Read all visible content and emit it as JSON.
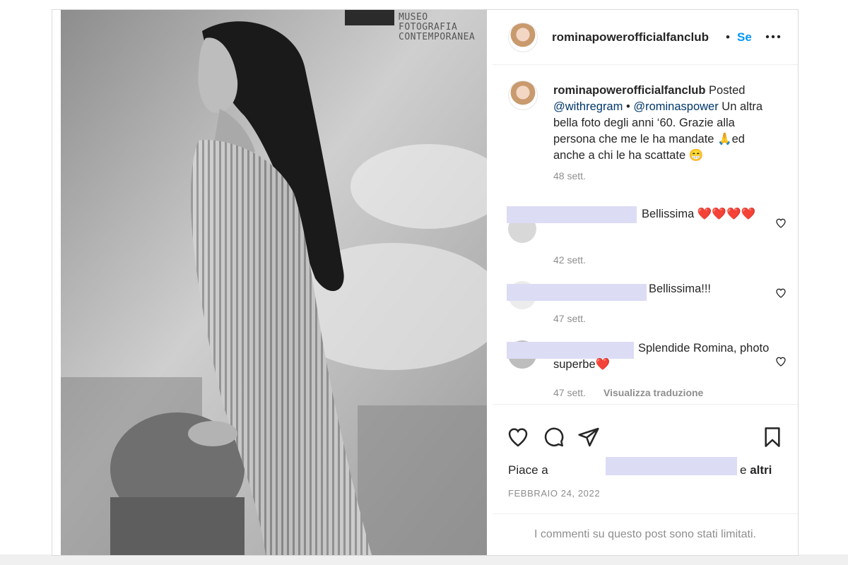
{
  "photo": {
    "alt_icon": "photo",
    "watermark_line1": "MUSEO FOTOGRAFIA",
    "watermark_line2": "CONTEMPORANEA"
  },
  "header": {
    "username": "rominapowerofficialfanclub",
    "separator": "•",
    "follow_label": "Se",
    "more_icon": "more-horizontal-icon"
  },
  "caption": {
    "username": "rominapowerofficialfanclub",
    "word_posted": "Posted",
    "mention1": "@withregram",
    "bullet": "•",
    "mention2": "@rominaspower",
    "body": "Un altra bella foto degli anni ‘60. Grazie alla persona che me le ha mandate 🙏ed anche a chi le ha scattate 😁",
    "time": "48 sett."
  },
  "comments": [
    {
      "text": "Bellissima ❤️❤️❤️❤️",
      "time": "42 sett."
    },
    {
      "text": "Bellissima!!!",
      "time": "47 sett."
    },
    {
      "text": "Splendide Romina, photo superbe❤️",
      "time": "47 sett.",
      "translate": "Visualizza traduzione"
    }
  ],
  "likes": {
    "prefix": "Piace a",
    "suffix_e": "e",
    "suffix_altri": "altri"
  },
  "date": "FEBBRAIO 24, 2022",
  "comments_limited": "I commenti su questo post sono stati limitati.",
  "colors": {
    "link": "#00376b",
    "follow": "#0095f6",
    "secondary": "#8e8e8e",
    "redaction": "#dcdcf5"
  }
}
